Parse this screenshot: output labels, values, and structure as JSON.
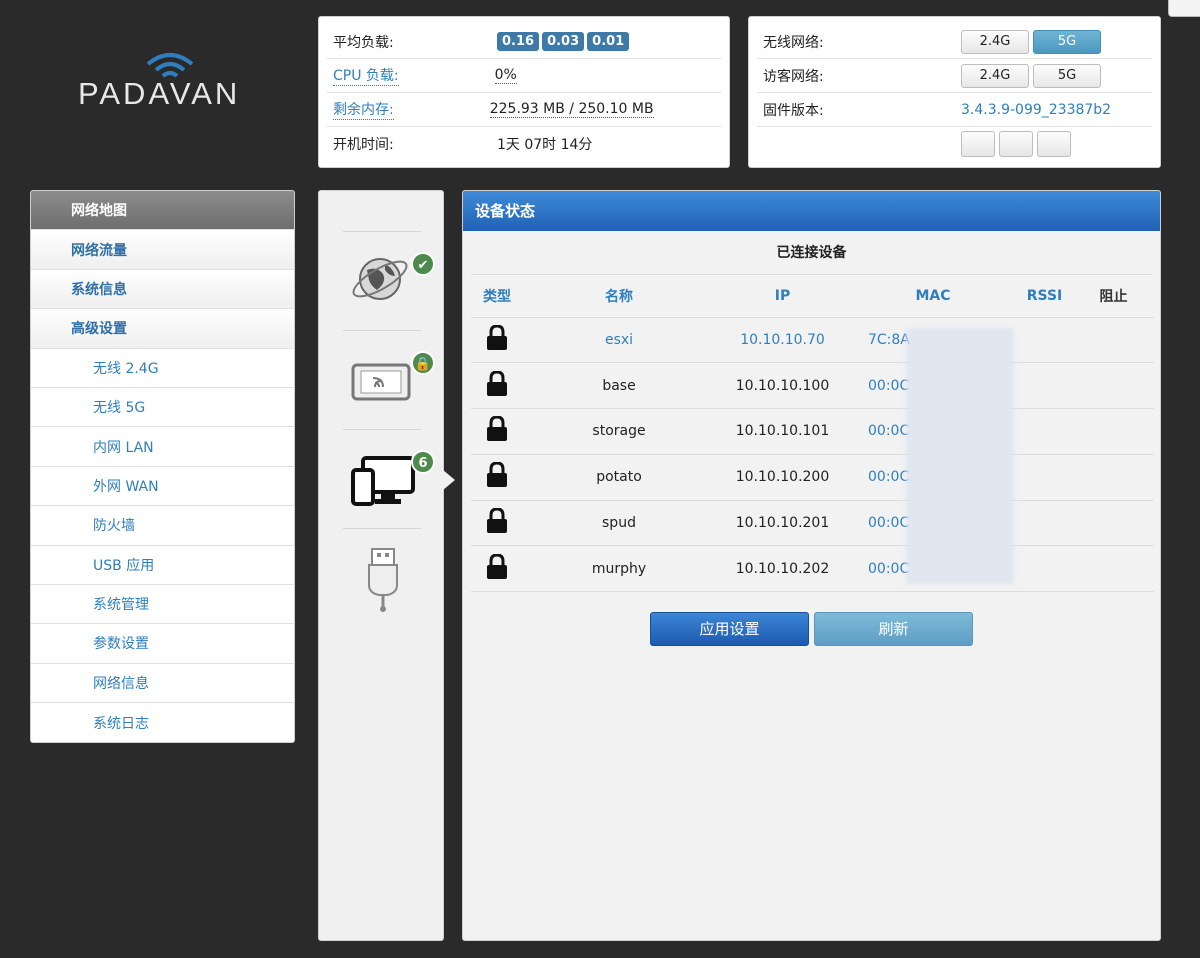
{
  "logo": {
    "text": "PADAVAN"
  },
  "status": {
    "load_label": "平均负载:",
    "load_values": [
      "0.16",
      "0.03",
      "0.01"
    ],
    "cpu_label": "CPU 负载:",
    "cpu_value": "0%",
    "mem_label": "剩余内存:",
    "mem_value": "225.93 MB / 250.10 MB",
    "uptime_label": "开机时间:",
    "uptime_value": "1天 07时 14分"
  },
  "wifi": {
    "wireless_label": "无线网络:",
    "guest_label": "访客网络:",
    "firmware_label": "固件版本:",
    "firmware_value": "3.4.3.9-099_23387b2",
    "band_24": "2.4G",
    "band_5": "5G",
    "active_band": "5G"
  },
  "sidebar": {
    "items": [
      {
        "label": "网络地图",
        "level": "top",
        "active": true
      },
      {
        "label": "网络流量",
        "level": "top"
      },
      {
        "label": "系统信息",
        "level": "top"
      },
      {
        "label": "高级设置",
        "level": "top"
      },
      {
        "label": "无线 2.4G",
        "level": "sub"
      },
      {
        "label": "无线 5G",
        "level": "sub"
      },
      {
        "label": "内网 LAN",
        "level": "sub"
      },
      {
        "label": "外网 WAN",
        "level": "sub"
      },
      {
        "label": "防火墙",
        "level": "sub"
      },
      {
        "label": "USB 应用",
        "level": "sub"
      },
      {
        "label": "系统管理",
        "level": "sub"
      },
      {
        "label": "参数设置",
        "level": "sub"
      },
      {
        "label": "网络信息",
        "level": "sub"
      },
      {
        "label": "系统日志",
        "level": "sub"
      }
    ]
  },
  "iconcol": {
    "clients_count": "6",
    "icons": [
      "internet-globe-icon",
      "wireless-device-icon",
      "clients-devices-icon",
      "usb-icon"
    ]
  },
  "main": {
    "header": "设备状态",
    "subtitle": "已连接设备",
    "columns": [
      "类型",
      "名称",
      "IP",
      "MAC",
      "RSSI",
      "阻止"
    ],
    "rows": [
      {
        "name": "esxi",
        "ip": "10.10.10.70",
        "mac": "7C:8A",
        "highlight": true
      },
      {
        "name": "base",
        "ip": "10.10.10.100",
        "mac": "00:0C"
      },
      {
        "name": "storage",
        "ip": "10.10.10.101",
        "mac": "00:0C"
      },
      {
        "name": "potato",
        "ip": "10.10.10.200",
        "mac": "00:0C"
      },
      {
        "name": "spud",
        "ip": "10.10.10.201",
        "mac": "00:0C"
      },
      {
        "name": "murphy",
        "ip": "10.10.10.202",
        "mac": "00:0C"
      }
    ],
    "apply_label": "应用设置",
    "refresh_label": "刷新"
  }
}
